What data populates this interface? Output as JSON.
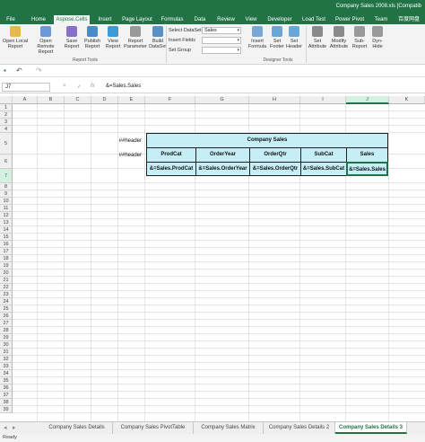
{
  "window": {
    "title": "Company Sales 2008.xls  [Compatib"
  },
  "tabs": [
    "File",
    "Home",
    "Aspose.Cells",
    "Insert",
    "Page Layout",
    "Formulas",
    "Data",
    "Review",
    "View",
    "Developer",
    "Load Test",
    "Power Pivot",
    "Team",
    "百度网盘"
  ],
  "ribbon": {
    "report_tools": {
      "buttons": [
        "Open Local Report",
        "Open Remote Report",
        "Save Report",
        "Publish Report",
        "View Report",
        "Report Parameter",
        "Build DataSet"
      ],
      "group_label": "Report Tools"
    },
    "dataset": {
      "select_dataset_label": "Select DataSet",
      "select_dataset_value": "Sales",
      "insert_fields_label": "Insert Fields",
      "set_group_label": "Set Group"
    },
    "designer_tools": {
      "buttons": [
        "Insert Formula",
        "Set Footer",
        "Set Header",
        "Set Attribute",
        "Modify Attribute",
        "Sub-Report",
        "Dyn-Hide"
      ],
      "group_label": "Designer Tools"
    }
  },
  "formula_bar": {
    "name_box": "J7",
    "cancel": "×",
    "enter": "✓",
    "fx": "fx",
    "formula": "&=Sales.Sales"
  },
  "grid": {
    "columns": [
      "A",
      "B",
      "C",
      "D",
      "E",
      "F",
      "G",
      "H",
      "I",
      "J",
      "K"
    ],
    "rows": [
      "1",
      "2",
      "3",
      "4",
      "5",
      "6",
      "7",
      "8",
      "9",
      "10",
      "11",
      "12",
      "13",
      "14",
      "15",
      "16",
      "17",
      "18",
      "19",
      "20",
      "21",
      "22",
      "23",
      "24",
      "25",
      "26",
      "27",
      "28",
      "29",
      "30",
      "31",
      "32",
      "33",
      "34",
      "35",
      "36",
      "37",
      "38",
      "39"
    ],
    "header_markers": [
      "##header",
      "##header"
    ],
    "title": "Company Sales",
    "column_headers": [
      "ProdCat",
      "OrderYear",
      "OrderQtr",
      "SubCat",
      "Sales"
    ],
    "field_markers": [
      "&=Sales.ProdCat",
      "&=Sales.OrderYear",
      "&=Sales.OrderQtr",
      "&=Sales.SubCat",
      "&=Sales.Sales"
    ]
  },
  "sheets": [
    "Company Sales Details",
    "Company Sales PivotTable",
    "Company Sales Matrix",
    "Company Sales Details 2",
    "Company Sales Details 3"
  ],
  "active_sheet_index": 4,
  "status": {
    "text": "Ready"
  },
  "colors": {
    "accent": "#217346",
    "table_fill": "#c6eef6"
  }
}
